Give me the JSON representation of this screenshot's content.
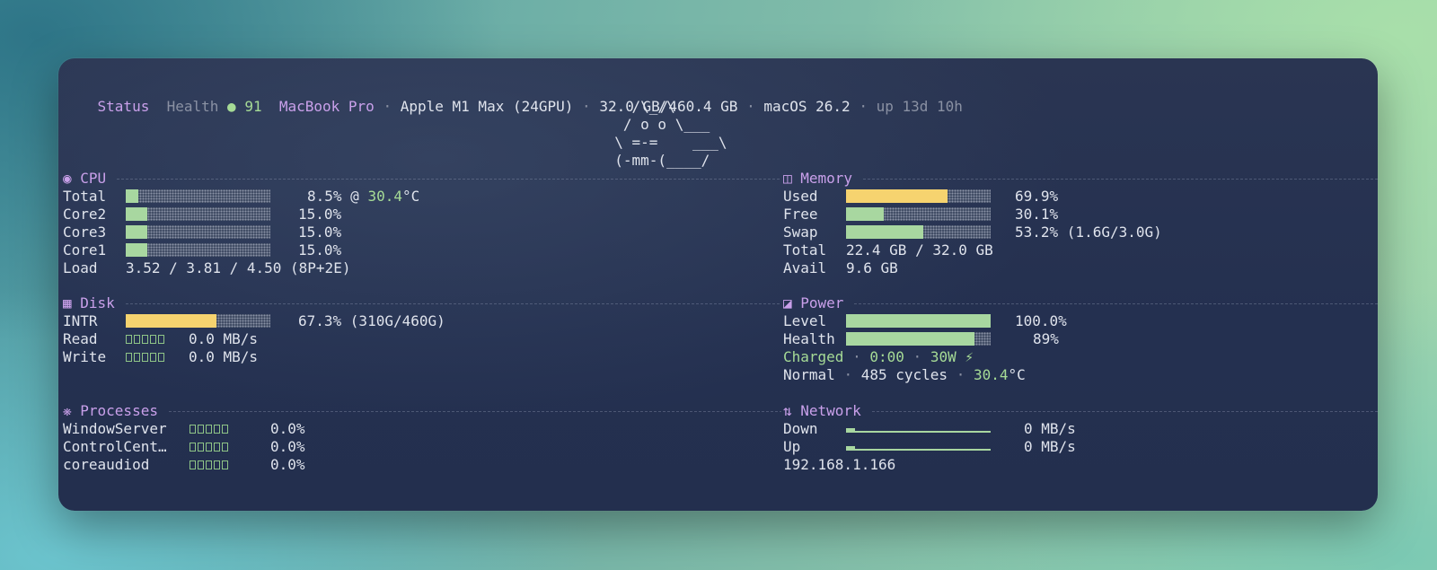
{
  "status": {
    "label": "Status",
    "health_label": "Health",
    "health_dot": "●",
    "health_value": "91",
    "device": "MacBook Pro",
    "sep": "·",
    "chip": "Apple M1 Max (24GPU)",
    "storage": "32.0 GB/460.4 GB",
    "os": "macOS 26.2",
    "uptime": "up 13d 10h"
  },
  "ascii_art": [
    "    /\\_/\\",
    "   / o o \\___",
    "  \\ =-=    ___\\",
    "  (-mm-(____/"
  ],
  "cpu": {
    "title": "◉ CPU",
    "rows": [
      {
        "label": "Total",
        "value": "8.5%",
        "at": "@",
        "temp": "30.4",
        "unit": "°C",
        "fraction": 0.085
      },
      {
        "label": "Core2",
        "value": "15.0%",
        "fraction": 0.15
      },
      {
        "label": "Core3",
        "value": "15.0%",
        "fraction": 0.15
      },
      {
        "label": "Core1",
        "value": "15.0%",
        "fraction": 0.15
      }
    ],
    "load_label": "Load",
    "load_value": "3.52 / 3.81 / 4.50 (8P+2E)"
  },
  "memory": {
    "title": "◫ Memory",
    "rows": [
      {
        "label": "Used",
        "value": "69.9%",
        "fraction": 0.699,
        "color": "#f6d36f"
      },
      {
        "label": "Free",
        "value": "30.1%",
        "fraction": 0.26,
        "color": "#a8d7a0"
      },
      {
        "label": "Swap",
        "value": "53.2% (1.6G/3.0G)",
        "fraction": 0.532,
        "color": "#a8d7a0"
      }
    ],
    "total_label": "Total",
    "total_value": "22.4 GB / 32.0 GB",
    "avail_label": "Avail",
    "avail_value": "9.6 GB"
  },
  "disk": {
    "title": "▦ Disk",
    "intr_label": "INTR",
    "intr_value": "67.3% (310G/460G)",
    "intr_fraction": 0.63,
    "read_label": "Read",
    "read_value": "0.0 MB/s",
    "write_label": "Write",
    "write_value": "0.0 MB/s"
  },
  "power": {
    "title": "◪ Power",
    "level_label": "Level",
    "level_value": "100.0%",
    "level_fraction": 1.0,
    "health_label": "Health",
    "health_value": "89%",
    "health_fraction": 0.89,
    "charged": "Charged",
    "sep": "·",
    "time": "0:00",
    "watts": "30W",
    "bolt": "⚡",
    "mode": "Normal",
    "cycles": "485 cycles",
    "temp": "30.4",
    "unit": "°C"
  },
  "processes": {
    "title": "❋ Processes",
    "rows": [
      {
        "name": "WindowServer",
        "value": "0.0%"
      },
      {
        "name": "ControlCent…",
        "value": "0.0%"
      },
      {
        "name": "coreaudiod",
        "value": "0.0%"
      }
    ]
  },
  "network": {
    "title": "⇅ Network",
    "down_label": "Down",
    "down_value": "0 MB/s",
    "up_label": "Up",
    "up_value": "0 MB/s",
    "ip": "192.168.1.166"
  },
  "colors": {
    "accent_purple": "#c9a0ea",
    "accent_green": "#a6db96",
    "bar_green": "#a8d7a0",
    "bar_yellow": "#f6d36f",
    "panel_bg": "#26324f"
  }
}
